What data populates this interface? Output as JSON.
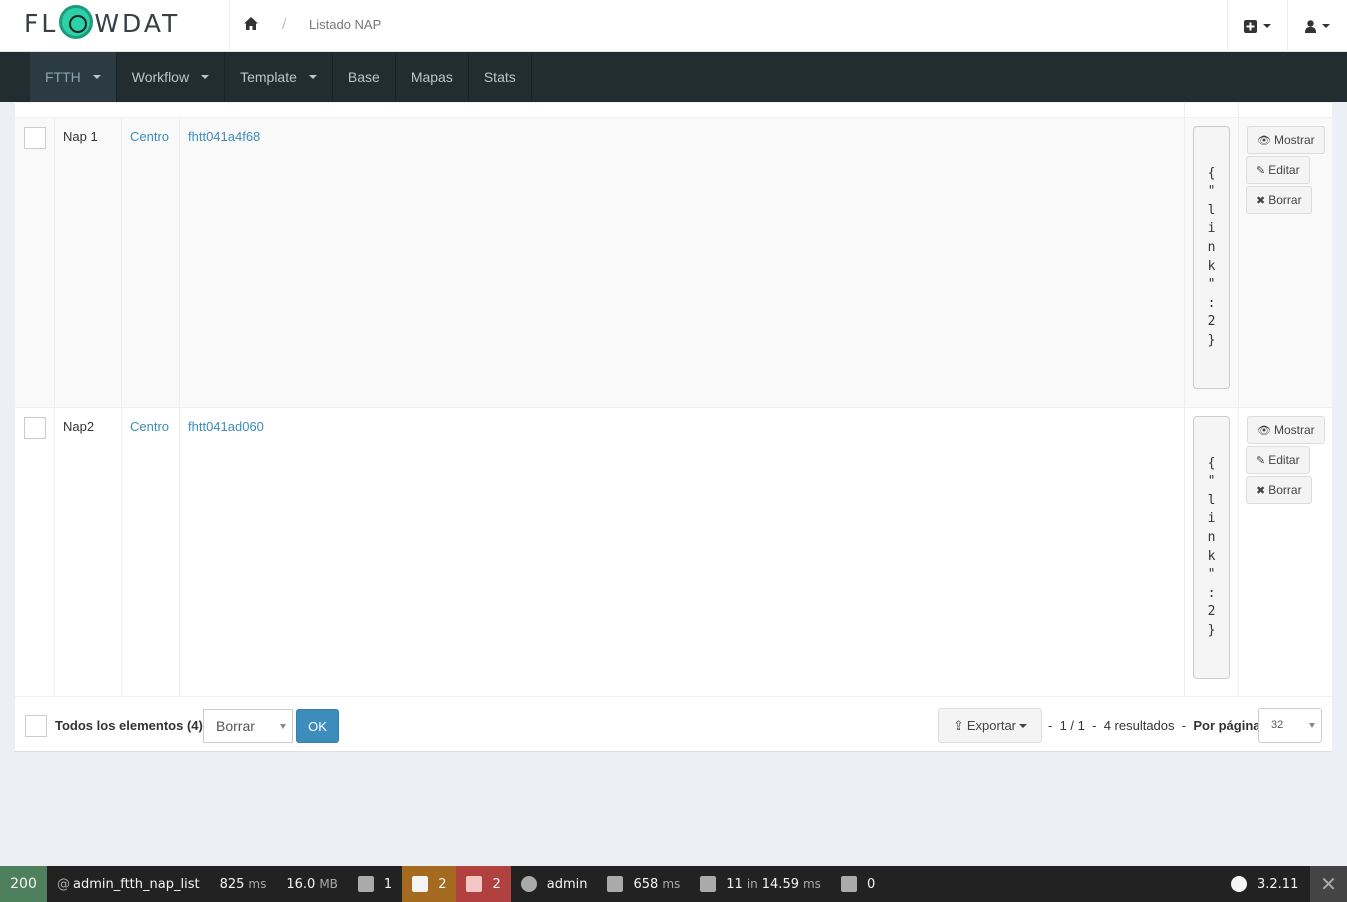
{
  "header": {
    "logo_text_1": "FL",
    "logo_text_2": "WDAT",
    "breadcrumb_home": "home-icon",
    "breadcrumb_separator": "/",
    "breadcrumb_current": "Listado NAP"
  },
  "nav": {
    "items": [
      {
        "label": "FTTH",
        "dropdown": true,
        "active": true
      },
      {
        "label": "Workflow",
        "dropdown": true
      },
      {
        "label": "Template",
        "dropdown": true
      },
      {
        "label": "Base",
        "dropdown": false
      },
      {
        "label": "Mapas",
        "dropdown": false
      },
      {
        "label": "Stats",
        "dropdown": false
      }
    ]
  },
  "table": {
    "rows": [
      {
        "name": "Nap 1",
        "zone": "Centro",
        "link": "fhtt041a4f68",
        "json_chars": [
          "{",
          "\"",
          "l",
          "i",
          "n",
          "k",
          "\"",
          ":",
          "2",
          "}"
        ]
      },
      {
        "name": "Nap2",
        "zone": "Centro",
        "link": "fhtt041ad060",
        "json_chars": [
          "{",
          "\"",
          "l",
          "i",
          "n",
          "k",
          "\"",
          ":",
          "2",
          "}"
        ]
      }
    ],
    "actions": {
      "show": "Mostrar",
      "edit": "Editar",
      "delete": "Borrar"
    }
  },
  "batch": {
    "all_label": "Todos los elementos (4)",
    "action_value": "Borrar",
    "ok_label": "OK",
    "export_label": "Exportar",
    "pager_prefix": "-",
    "pager_pages": "1 / 1",
    "pager_sep": "-",
    "pager_results": "4 resultados",
    "pager_sep2": "-",
    "per_page_label": "Por página",
    "per_page_value": "32"
  },
  "symfony_toolbar": {
    "status_code": "200",
    "route": "admin_ftth_nap_list",
    "time_value": "825",
    "time_unit": "ms",
    "memory_value": "16.0",
    "memory_unit": "MB",
    "logs_count": "1",
    "warnings_count": "2",
    "translations_count": "2",
    "user": "admin",
    "render_time": "658",
    "render_unit": "ms",
    "db_queries": "11",
    "db_in": "in",
    "db_time": "14.59",
    "db_unit": "ms",
    "forms_count": "0",
    "version": "3.2.11",
    "colors": {
      "status_ok": "#4f805d",
      "warning": "#a46a1f",
      "error": "#b0413e"
    }
  }
}
